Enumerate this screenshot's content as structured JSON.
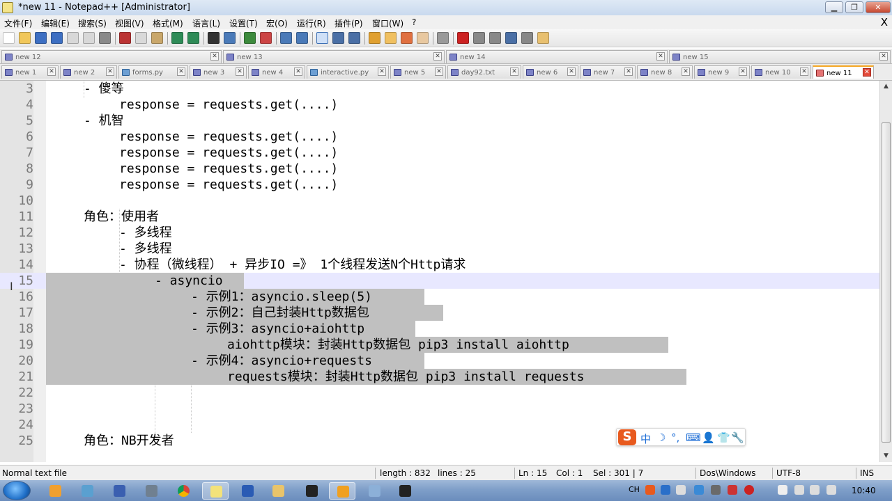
{
  "window": {
    "title": "*new 11 - Notepad++ [Administrator]",
    "min": "▁",
    "max": "❐",
    "close": "✕"
  },
  "menu": {
    "items": [
      "文件(F)",
      "编辑(E)",
      "搜索(S)",
      "视图(V)",
      "格式(M)",
      "语言(L)",
      "设置(T)",
      "宏(O)",
      "运行(R)",
      "插件(P)",
      "窗口(W)",
      "?"
    ],
    "close_doc": "X"
  },
  "toolbar": {
    "icons": [
      "new-file-icon",
      "open-file-icon",
      "save-icon",
      "save-all-icon",
      "close-icon",
      "close-all-icon",
      "print-icon",
      "cut-icon",
      "copy-icon",
      "paste-icon",
      "undo-icon",
      "redo-icon",
      "find-icon",
      "replace-icon",
      "zoom-in-icon",
      "zoom-out-icon",
      "sync-vertical-icon",
      "sync-horizontal-icon",
      "word-wrap-icon",
      "show-all-chars-icon",
      "indent-guide-icon",
      "udl-icon",
      "doc-map-icon",
      "function-list-icon",
      "folder-workspace-icon",
      "monitor-icon",
      "record-macro-icon",
      "stop-record-icon",
      "play-macro-icon",
      "run-macro-multiple-icon",
      "save-macro-icon",
      "plugin-icon"
    ]
  },
  "tabs_row1": [
    {
      "label": "new 12"
    },
    {
      "label": "new 13"
    },
    {
      "label": "new 14"
    },
    {
      "label": "new 15"
    }
  ],
  "tabs_row2": [
    {
      "label": "new 1",
      "type": "txt"
    },
    {
      "label": "new 2",
      "type": "txt"
    },
    {
      "label": "forms.py",
      "type": "py"
    },
    {
      "label": "new 3",
      "type": "txt"
    },
    {
      "label": "new 4",
      "type": "txt"
    },
    {
      "label": "interactive.py",
      "type": "py"
    },
    {
      "label": "new 5",
      "type": "txt"
    },
    {
      "label": "day92.txt",
      "type": "txt"
    },
    {
      "label": "new 6",
      "type": "txt"
    },
    {
      "label": "new 7",
      "type": "txt"
    },
    {
      "label": "new 8",
      "type": "txt"
    },
    {
      "label": "new 9",
      "type": "txt"
    },
    {
      "label": "new 10",
      "type": "txt"
    },
    {
      "label": "new 11",
      "type": "txt",
      "active": true
    }
  ],
  "editor": {
    "current_line": 15,
    "lines": [
      {
        "n": "3",
        "text": "- 傻等",
        "indent": 2,
        "sel": false
      },
      {
        "n": "4",
        "text": "response = requests.get(....)",
        "indent": 3,
        "sel": false
      },
      {
        "n": "5",
        "text": "- 机智",
        "indent": 2,
        "sel": false
      },
      {
        "n": "6",
        "text": "response = requests.get(....)",
        "indent": 3,
        "sel": false
      },
      {
        "n": "7",
        "text": "response = requests.get(....)",
        "indent": 3,
        "sel": false
      },
      {
        "n": "8",
        "text": "response = requests.get(....)",
        "indent": 3,
        "sel": false
      },
      {
        "n": "9",
        "text": "response = requests.get(....)",
        "indent": 3,
        "sel": false
      },
      {
        "n": "10",
        "text": "",
        "indent": 0,
        "sel": false
      },
      {
        "n": "11",
        "text": "角色：使用者",
        "indent": 2,
        "sel": false
      },
      {
        "n": "12",
        "text": "- 多线程",
        "indent": 3,
        "sel": false
      },
      {
        "n": "13",
        "text": "- 多线程",
        "indent": 3,
        "sel": false
      },
      {
        "n": "14",
        "text": "- 协程（微线程） + 异步IO =》 1个线程发送N个Http请求",
        "indent": 3,
        "sel": false
      },
      {
        "n": "15",
        "text": "- asyncio",
        "indent": 4,
        "sel": true
      },
      {
        "n": "16",
        "text": "- 示例1：asyncio.sleep(5)",
        "indent": 5,
        "sel": true
      },
      {
        "n": "17",
        "text": "- 示例2：自己封装Http数据包",
        "indent": 5,
        "sel": true
      },
      {
        "n": "18",
        "text": "- 示例3：asyncio+aiohttp",
        "indent": 5,
        "sel": true
      },
      {
        "n": "19",
        "text": "aiohttp模块：封装Http数据包 pip3 install aiohttp",
        "indent": 6,
        "sel": true
      },
      {
        "n": "20",
        "text": "- 示例4：asyncio+requests",
        "indent": 5,
        "sel": true
      },
      {
        "n": "21",
        "text": "requests模块：封装Http数据包 pip3 install requests",
        "indent": 6,
        "sel": true
      },
      {
        "n": "22",
        "text": "",
        "indent": 0,
        "sel": false
      },
      {
        "n": "23",
        "text": "",
        "indent": 0,
        "sel": false
      },
      {
        "n": "24",
        "text": "",
        "indent": 0,
        "sel": false
      },
      {
        "n": "25",
        "text": "角色：NB开发者",
        "indent": 2,
        "sel": false
      }
    ]
  },
  "statusbar": {
    "filetype": "Normal text file",
    "length": "length : 832",
    "lines": "lines : 25",
    "ln": "Ln : 15",
    "col": "Col : 1",
    "sel": "Sel : 301 | 7",
    "eol": "Dos\\Windows",
    "encoding": "UTF-8",
    "mode": "INS"
  },
  "ime": {
    "logo": "S",
    "items": [
      "中",
      "☽",
      "°,",
      "⌨",
      "👤",
      "👕",
      "🔧"
    ]
  },
  "taskbar": {
    "clock": "10:40",
    "lang": "CH",
    "apps": [
      "firefox-icon",
      "paint-icon",
      "save-icon",
      "cmd-tool-icon",
      "chrome-icon",
      "notepadpp-icon",
      "word-icon",
      "explorer-icon",
      "pycharm-icon",
      "sticky-icon",
      "vm-icon",
      "terminal-icon"
    ]
  },
  "colors": {
    "selection": "#c0c0c0",
    "current_line": "#e8e8ff",
    "gutter": "#e4e4e4",
    "tab_active_accent": "#f5a623"
  }
}
